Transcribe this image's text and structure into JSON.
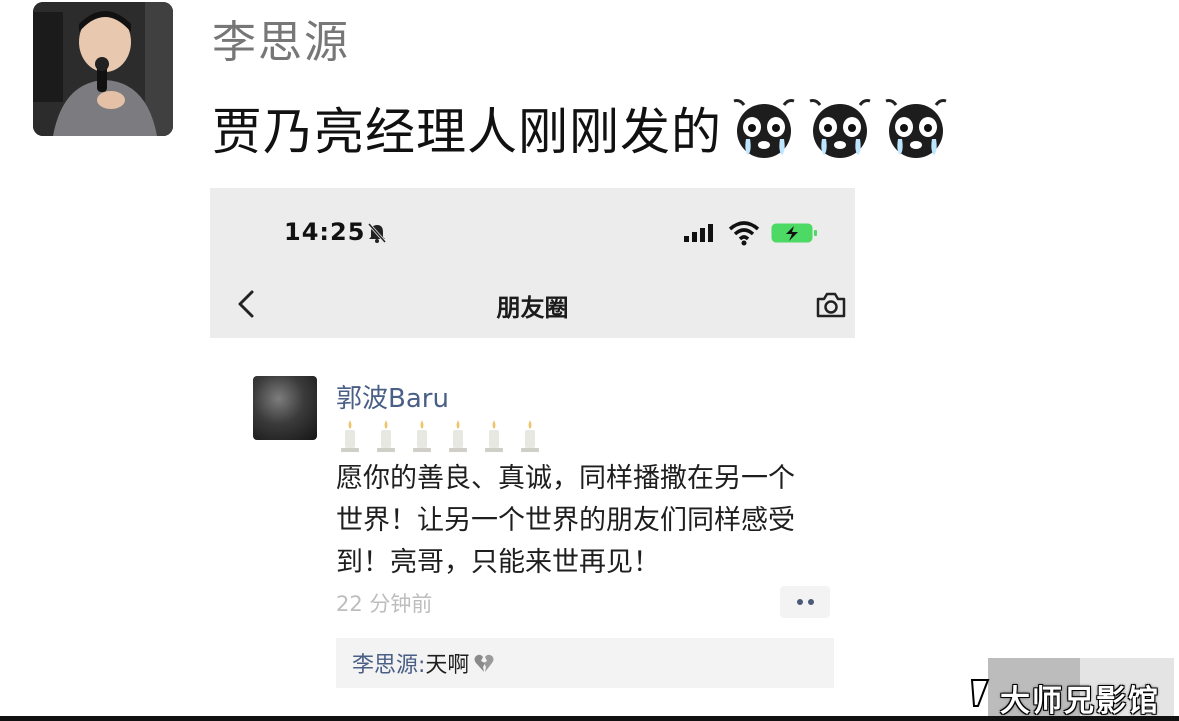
{
  "chat": {
    "sender_name": "李思源",
    "message_text": "贾乃亮经理人刚刚发的",
    "emojis": [
      "crying-face-emoji",
      "crying-face-emoji",
      "crying-face-emoji"
    ]
  },
  "screenshot": {
    "status_bar": {
      "time": "14:25",
      "icons": [
        "bell-muted-icon",
        "signal-icon",
        "wifi-icon",
        "battery-charging-icon"
      ]
    },
    "nav": {
      "title": "朋友圈",
      "back_icon": "chevron-left-icon",
      "right_icon": "camera-icon"
    },
    "post": {
      "author": "郭波Baru",
      "candle_count": 6,
      "text_lines": [
        "愿你的善良、真诚，同样播撒在另一个",
        "世界！让另一个世界的朋友们同样感受",
        "到！亮哥，只能来世再见！"
      ],
      "time_ago": "22 分钟前",
      "more_icon": "more-dots-icon",
      "comment": {
        "author": "李思源:",
        "text": " 天啊",
        "emoji": "broken-heart-icon"
      }
    }
  },
  "watermark": {
    "text": "大师兄影馆"
  },
  "colors": {
    "link_blue": "#4a5f86",
    "battery_green": "#4cd964",
    "nav_bg": "#ececec"
  }
}
